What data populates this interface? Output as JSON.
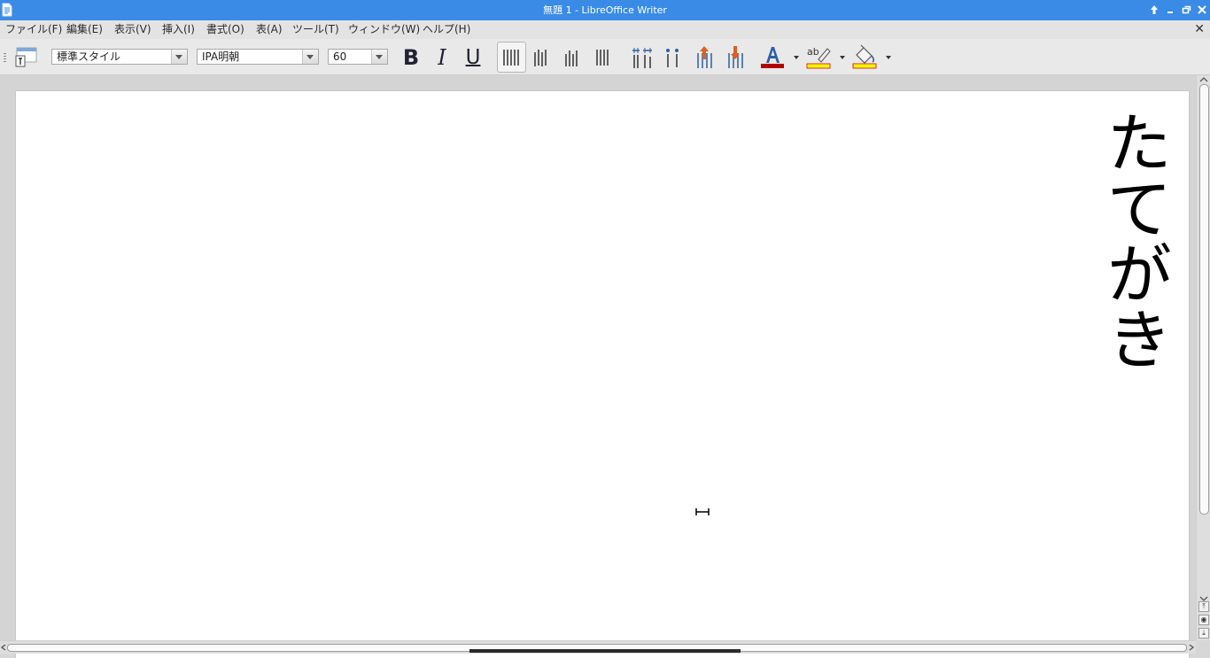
{
  "window": {
    "title": "無題 1 - LibreOffice Writer",
    "controls": [
      "pin-up-icon",
      "minimize-icon",
      "maximize-icon",
      "close-icon"
    ]
  },
  "menu": {
    "items": [
      "ファイル(F)",
      "編集(E)",
      "表示(V)",
      "挿入(I)",
      "書式(O)",
      "表(A)",
      "ツール(T)",
      "ウィンドウ(W)",
      "ヘルプ(H)"
    ],
    "close_symbol": "✕"
  },
  "toolbar": {
    "paragraph_style": "標準スタイル",
    "font_name": "IPA明朝",
    "font_size": "60",
    "bold_label": "B",
    "italic_label": "I",
    "underline_label": "U",
    "font_color": "#b00000",
    "highlight_color": "#ffff00",
    "background_color": "#ffff00"
  },
  "document": {
    "text": "たてがき",
    "writing_mode": "vertical-rl"
  },
  "colors": {
    "titlebar": "#3a8be6",
    "page": "#ffffff",
    "workspace": "#d4d4d4"
  }
}
